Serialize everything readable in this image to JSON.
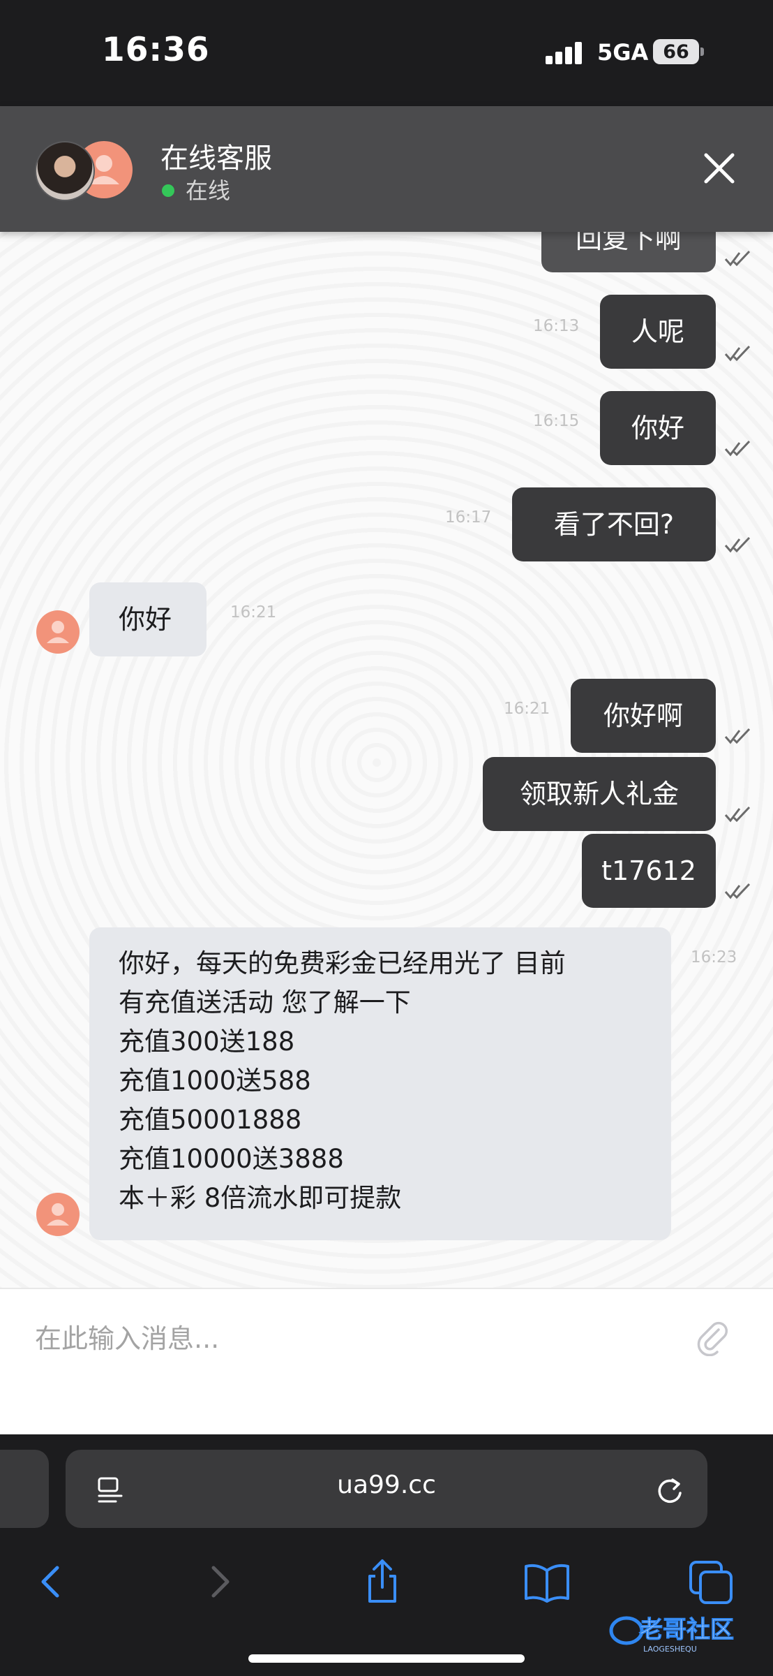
{
  "status_bar": {
    "time": "16:36",
    "network": "5GA",
    "battery": "66"
  },
  "header": {
    "title": "在线客服",
    "status": "在线"
  },
  "messages": [
    {
      "dir": "out",
      "text": "回复下啊",
      "time": ""
    },
    {
      "dir": "out",
      "text": "人呢",
      "time": "16:13"
    },
    {
      "dir": "out",
      "text": "你好",
      "time": "16:15"
    },
    {
      "dir": "out",
      "text": "看了不回?",
      "time": "16:17"
    },
    {
      "dir": "in",
      "text": "你好",
      "time": "16:21"
    },
    {
      "dir": "out",
      "text": "你好啊",
      "time": "16:21"
    },
    {
      "dir": "out",
      "text": "领取新人礼金",
      "time": ""
    },
    {
      "dir": "out",
      "text": "t17612",
      "time": ""
    },
    {
      "dir": "in",
      "lines": [
        "你好，每天的免费彩金已经用光了 目前",
        "有充值送活动 您了解一下",
        "充值300送188",
        "充值1000送588",
        "充值50001888",
        "充值10000送3888",
        "本＋彩 8倍流水即可提款"
      ],
      "time": "16:23"
    }
  ],
  "composer": {
    "placeholder": "在此输入消息..."
  },
  "browser": {
    "url": "ua99.cc"
  },
  "watermark": {
    "text": "老哥社区",
    "subtext": "LAOGESHEQU"
  },
  "colors": {
    "header_bg": "#4b4b4d",
    "outgoing_bubble": "#3a3a3c",
    "incoming_bubble": "#e6e8ec",
    "online_dot": "#34c759",
    "agent_avatar": "#f2937a",
    "toolbar_icons": "#3a8ef7"
  },
  "icons": [
    "close-icon",
    "person-icon",
    "double-check-icon",
    "paperclip-icon",
    "reader-icon",
    "reload-icon",
    "back-icon",
    "forward-icon",
    "share-icon",
    "bookmarks-icon",
    "tabs-icon"
  ]
}
